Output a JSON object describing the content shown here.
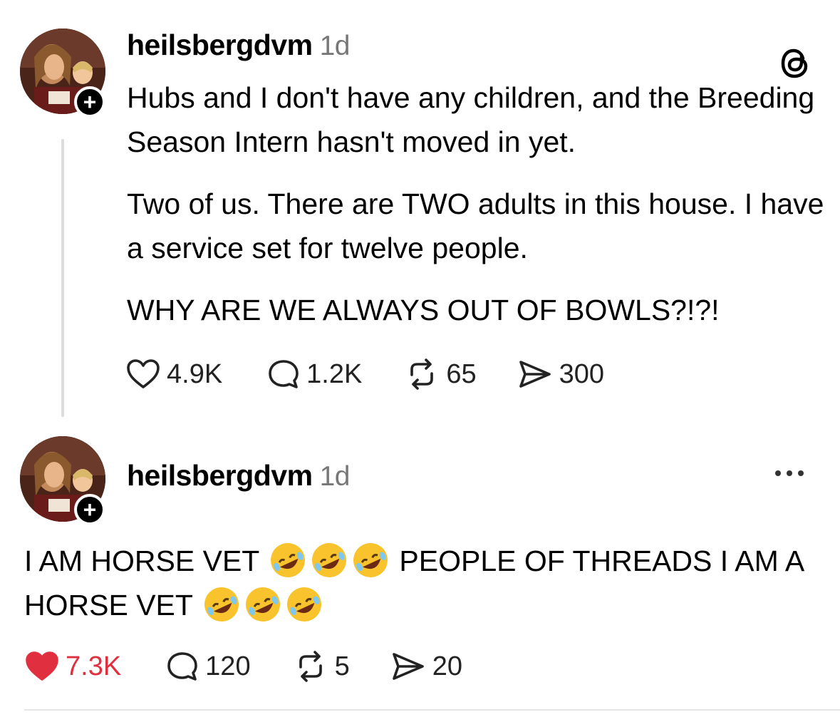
{
  "post1": {
    "username": "heilsbergdvm",
    "time": "1d",
    "paragraphs": [
      "Hubs and I don't have any children, and the Breeding Season Intern hasn't moved in yet.",
      "Two of us. There are TWO adults in this house. I have a service set for twelve people.",
      "WHY ARE WE ALWAYS OUT OF BOWLS?!?!"
    ],
    "likes": "4.9K",
    "replies": "1.2K",
    "reposts": "65",
    "shares": "300"
  },
  "post2": {
    "username": "heilsbergdvm",
    "time": "1d",
    "text_a": "I AM HORSE VET",
    "text_b": "PEOPLE OF THREADS I AM A HORSE VET",
    "likes": "7.3K",
    "replies": "120",
    "reposts": "5",
    "shares": "20"
  },
  "icons": {
    "follow": "plus-icon",
    "app": "threads-logo-icon",
    "like": "heart-icon",
    "reply": "comment-bubble-icon",
    "repost": "repost-icon",
    "share": "send-icon",
    "more": "more-dots-icon",
    "emoji": "rolling-on-floor-laughing-emoji"
  },
  "colors": {
    "liked": "#e0303f",
    "muted": "#777777",
    "thread_line": "#dcdcdc"
  }
}
